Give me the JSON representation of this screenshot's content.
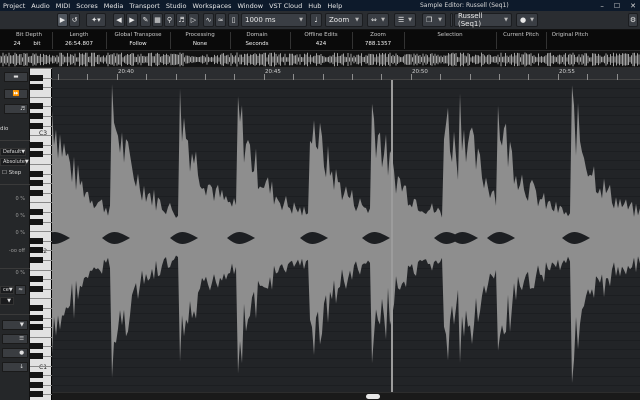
{
  "menu": {
    "items": [
      "Project",
      "Audio",
      "MIDI",
      "Scores",
      "Media",
      "Transport",
      "Studio",
      "Workspaces",
      "Window",
      "VST Cloud",
      "Hub",
      "Help"
    ],
    "window_title": "Sample Editor: Russell (Seq1)"
  },
  "toolbar": {
    "grid_length": "1000 ms",
    "zoom_mode": "Zoom",
    "clip_name": "Russell (Seq1)"
  },
  "info_line": {
    "columns": [
      {
        "header": "Bit Depth",
        "value": "24",
        "unit": "bit"
      },
      {
        "header": "Length",
        "value": "26:54.807"
      },
      {
        "header": "Global Transpose",
        "value": "Follow"
      },
      {
        "header": "Processing",
        "value": "None"
      },
      {
        "header": "Domain",
        "value": "Seconds"
      },
      {
        "header": "Offline Edits",
        "value": "424"
      },
      {
        "header": "Zoom",
        "value": "788.1357"
      },
      {
        "header": "Selection",
        "value": ""
      },
      {
        "header": "Current Pitch",
        "value": ""
      },
      {
        "header": "Original Pitch",
        "value": ""
      }
    ]
  },
  "inspector": {
    "section_label": "dio",
    "mode_default": "Default",
    "mode_absolute": "Absolute",
    "step_label": "Step",
    "pct1": "0 %",
    "pct2": "0 %",
    "pct3": "0 %",
    "pct4": "0 %",
    "off_value": "-oo off",
    "select_value": "ce"
  },
  "keyboard": {
    "labels": [
      "C3",
      "C2",
      "C1"
    ]
  },
  "ruler": {
    "labels": [
      "20:40",
      "20:45",
      "20:50",
      "20:55"
    ]
  },
  "colors": {
    "menubar": "#0d1a2b",
    "waveform": "#8e8e8e",
    "background": "#222427"
  }
}
